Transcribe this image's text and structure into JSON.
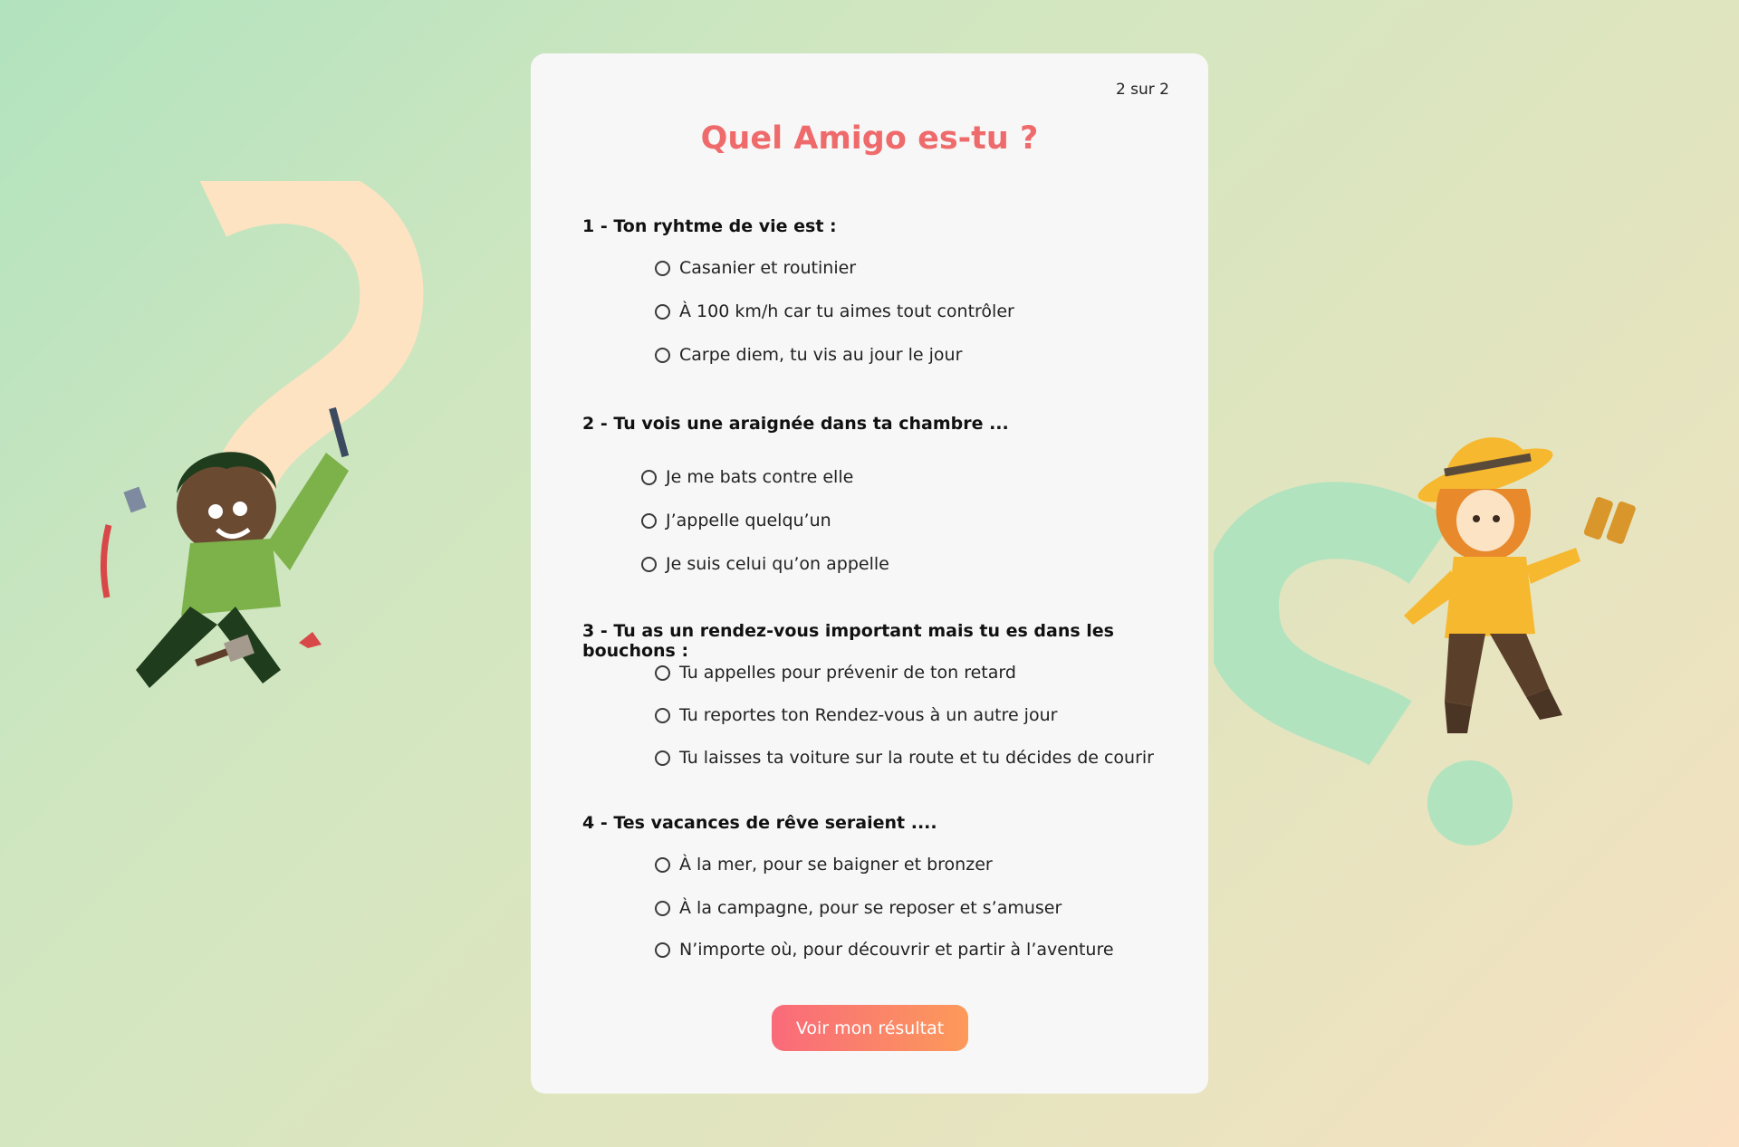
{
  "quiz": {
    "step": "2 sur 2",
    "title": "Quel Amigo es-tu ?",
    "questions": [
      {
        "label": "1 - Ton ryhtme de vie  est :",
        "options": [
          "Casanier et routinier",
          "À 100 km/h car tu aimes tout contrôler",
          "Carpe diem, tu vis au jour le jour"
        ]
      },
      {
        "label": "2 - Tu vois une araignée dans ta chambre ...",
        "options": [
          "Je  me bats contre elle",
          "J’appelle quelqu’un",
          "Je suis celui qu’on appelle"
        ]
      },
      {
        "label": "3 - Tu as un rendez-vous important mais tu es dans les bouchons :",
        "options": [
          "Tu appelles pour prévenir de ton retard",
          "Tu reportes ton Rendez-vous à un autre jour",
          "Tu laisses ta voiture  sur la route et tu décides de courir"
        ]
      },
      {
        "label": "4 - Tes vacances de rêve seraient  ....",
        "options": [
          "À la mer, pour se baigner et bronzer",
          "À la campagne, pour se reposer et s’amuser",
          "N’importe où, pour découvrir et partir à l’aventure"
        ]
      }
    ],
    "submit_label": "Voir mon résultat"
  },
  "colors": {
    "title": "#ef6b6b",
    "button_start": "#f96a7a",
    "button_end": "#fc9a5a",
    "left_question_mark": "#fde3c2",
    "right_question_mark": "#b1e3bf"
  }
}
